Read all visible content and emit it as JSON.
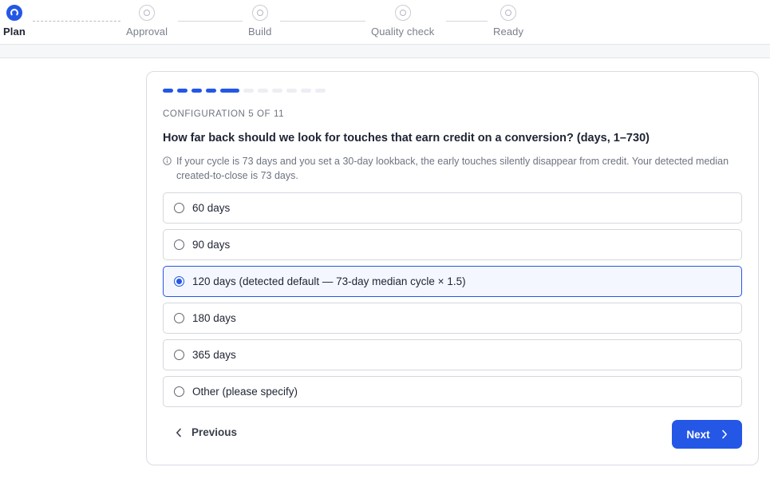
{
  "stepper": {
    "steps": [
      {
        "label": "Plan",
        "state": "active"
      },
      {
        "label": "Approval",
        "state": "pending"
      },
      {
        "label": "Build",
        "state": "pending"
      },
      {
        "label": "Quality check",
        "state": "pending"
      },
      {
        "label": "Ready",
        "state": "pending"
      }
    ]
  },
  "wizard": {
    "progress": {
      "current": 5,
      "total": 11
    },
    "config_label": "CONFIGURATION 5 OF 11",
    "question": "How far back should we look for touches that earn credit on a conversion? (days, 1–730)",
    "hint": "If your cycle is 73 days and you set a 30-day lookback, the early touches silently disappear from credit. Your detected median created-to-close is 73 days.",
    "options": [
      {
        "label": "60 days",
        "selected": false
      },
      {
        "label": "90 days",
        "selected": false
      },
      {
        "label": "120 days (detected default — 73-day median cycle × 1.5)",
        "selected": true
      },
      {
        "label": "180 days",
        "selected": false
      },
      {
        "label": "365 days",
        "selected": false
      },
      {
        "label": "Other (please specify)",
        "selected": false
      }
    ],
    "previous_label": "Previous",
    "next_label": "Next"
  },
  "colors": {
    "accent": "#2457e6",
    "selected_bg": "#f4f7ff",
    "muted_text": "#6e7380"
  }
}
